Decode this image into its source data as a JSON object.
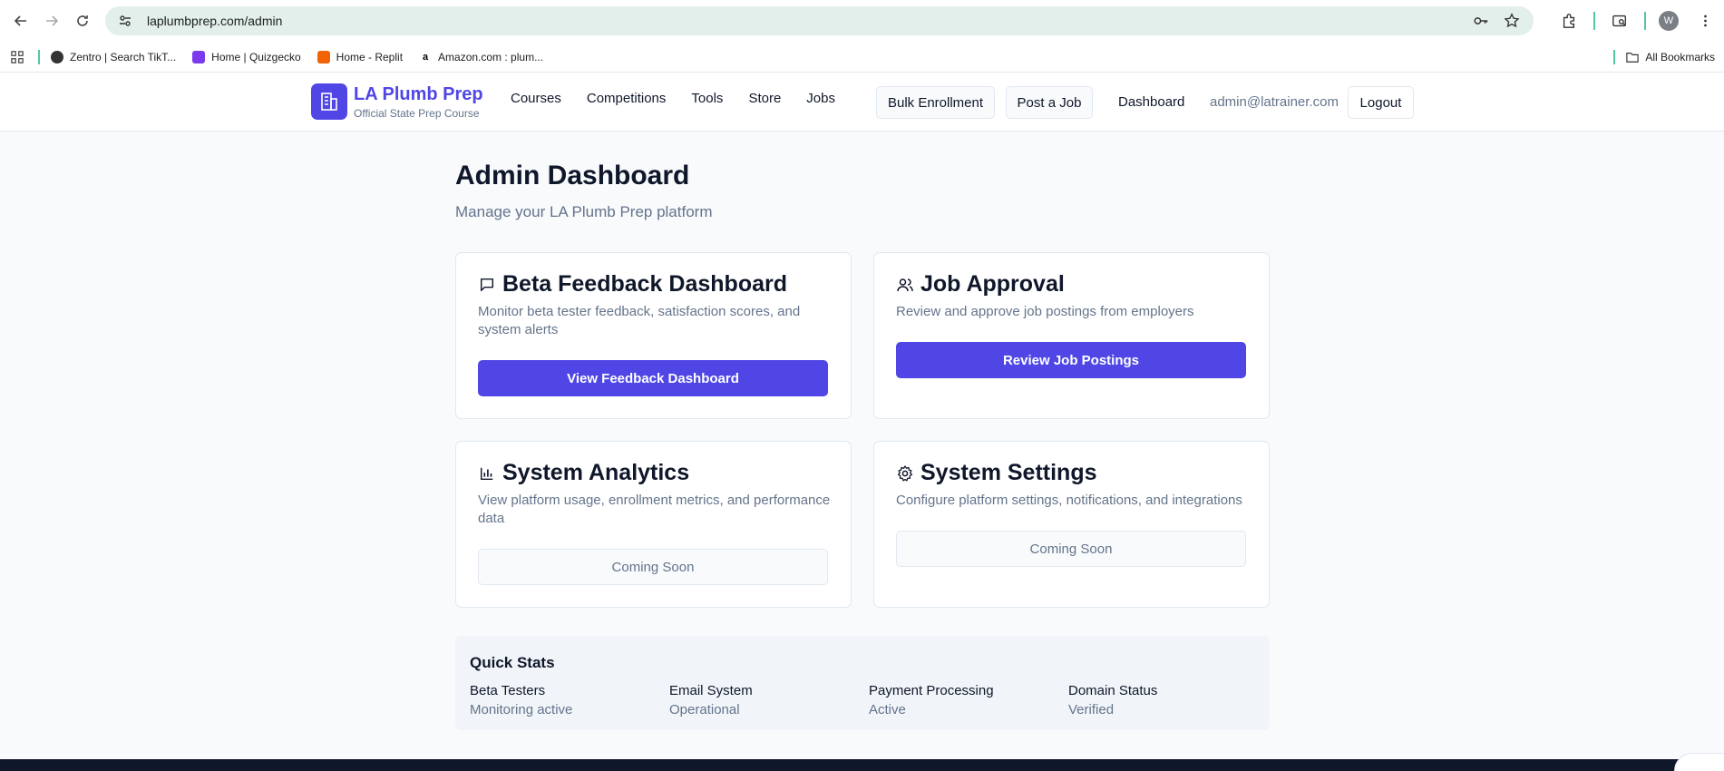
{
  "browser": {
    "url": "laplumbprep.com/admin",
    "profile_initial": "W",
    "bookmarks": [
      {
        "label": "Zentro | Search TikT...",
        "icon": "globe-icon"
      },
      {
        "label": "Home | Quizgecko",
        "icon": "quizgecko-icon"
      },
      {
        "label": "Home - Replit",
        "icon": "replit-icon"
      },
      {
        "label": "Amazon.com : plum...",
        "icon": "amazon-icon"
      }
    ],
    "all_bookmarks": "All Bookmarks"
  },
  "header": {
    "brand_title": "LA Plumb Prep",
    "brand_subtitle": "Official State Prep Course",
    "nav": [
      "Courses",
      "Competitions",
      "Tools",
      "Store",
      "Jobs"
    ],
    "bulk_enrollment": "Bulk Enrollment",
    "post_job": "Post a Job",
    "dashboard": "Dashboard",
    "email": "admin@latrainer.com",
    "logout": "Logout"
  },
  "main": {
    "title": "Admin Dashboard",
    "subtitle": "Manage your LA Plumb Prep platform",
    "cards": [
      {
        "title": "Beta Feedback Dashboard",
        "icon": "message-square-icon",
        "desc": "Monitor beta tester feedback, satisfaction scores, and system alerts",
        "button": "View Feedback Dashboard"
      },
      {
        "title": "Job Approval",
        "icon": "users-icon",
        "desc": "Review and approve job postings from employers",
        "button": "Review Job Postings"
      },
      {
        "title": "System Analytics",
        "icon": "bar-chart-icon",
        "desc": "View platform usage, enrollment metrics, and performance data",
        "button": "Coming Soon"
      },
      {
        "title": "System Settings",
        "icon": "gear-icon",
        "desc": "Configure platform settings, notifications, and integrations",
        "button": "Coming Soon"
      }
    ],
    "quick_stats": {
      "title": "Quick Stats",
      "items": [
        {
          "label": "Beta Testers",
          "value": "Monitoring active"
        },
        {
          "label": "Email System",
          "value": "Operational"
        },
        {
          "label": "Payment Processing",
          "value": "Active"
        },
        {
          "label": "Domain Status",
          "value": "Verified"
        }
      ]
    }
  },
  "colors": {
    "accent": "#4f46e5",
    "muted": "#64748b",
    "page_bg": "#f8fafc"
  }
}
